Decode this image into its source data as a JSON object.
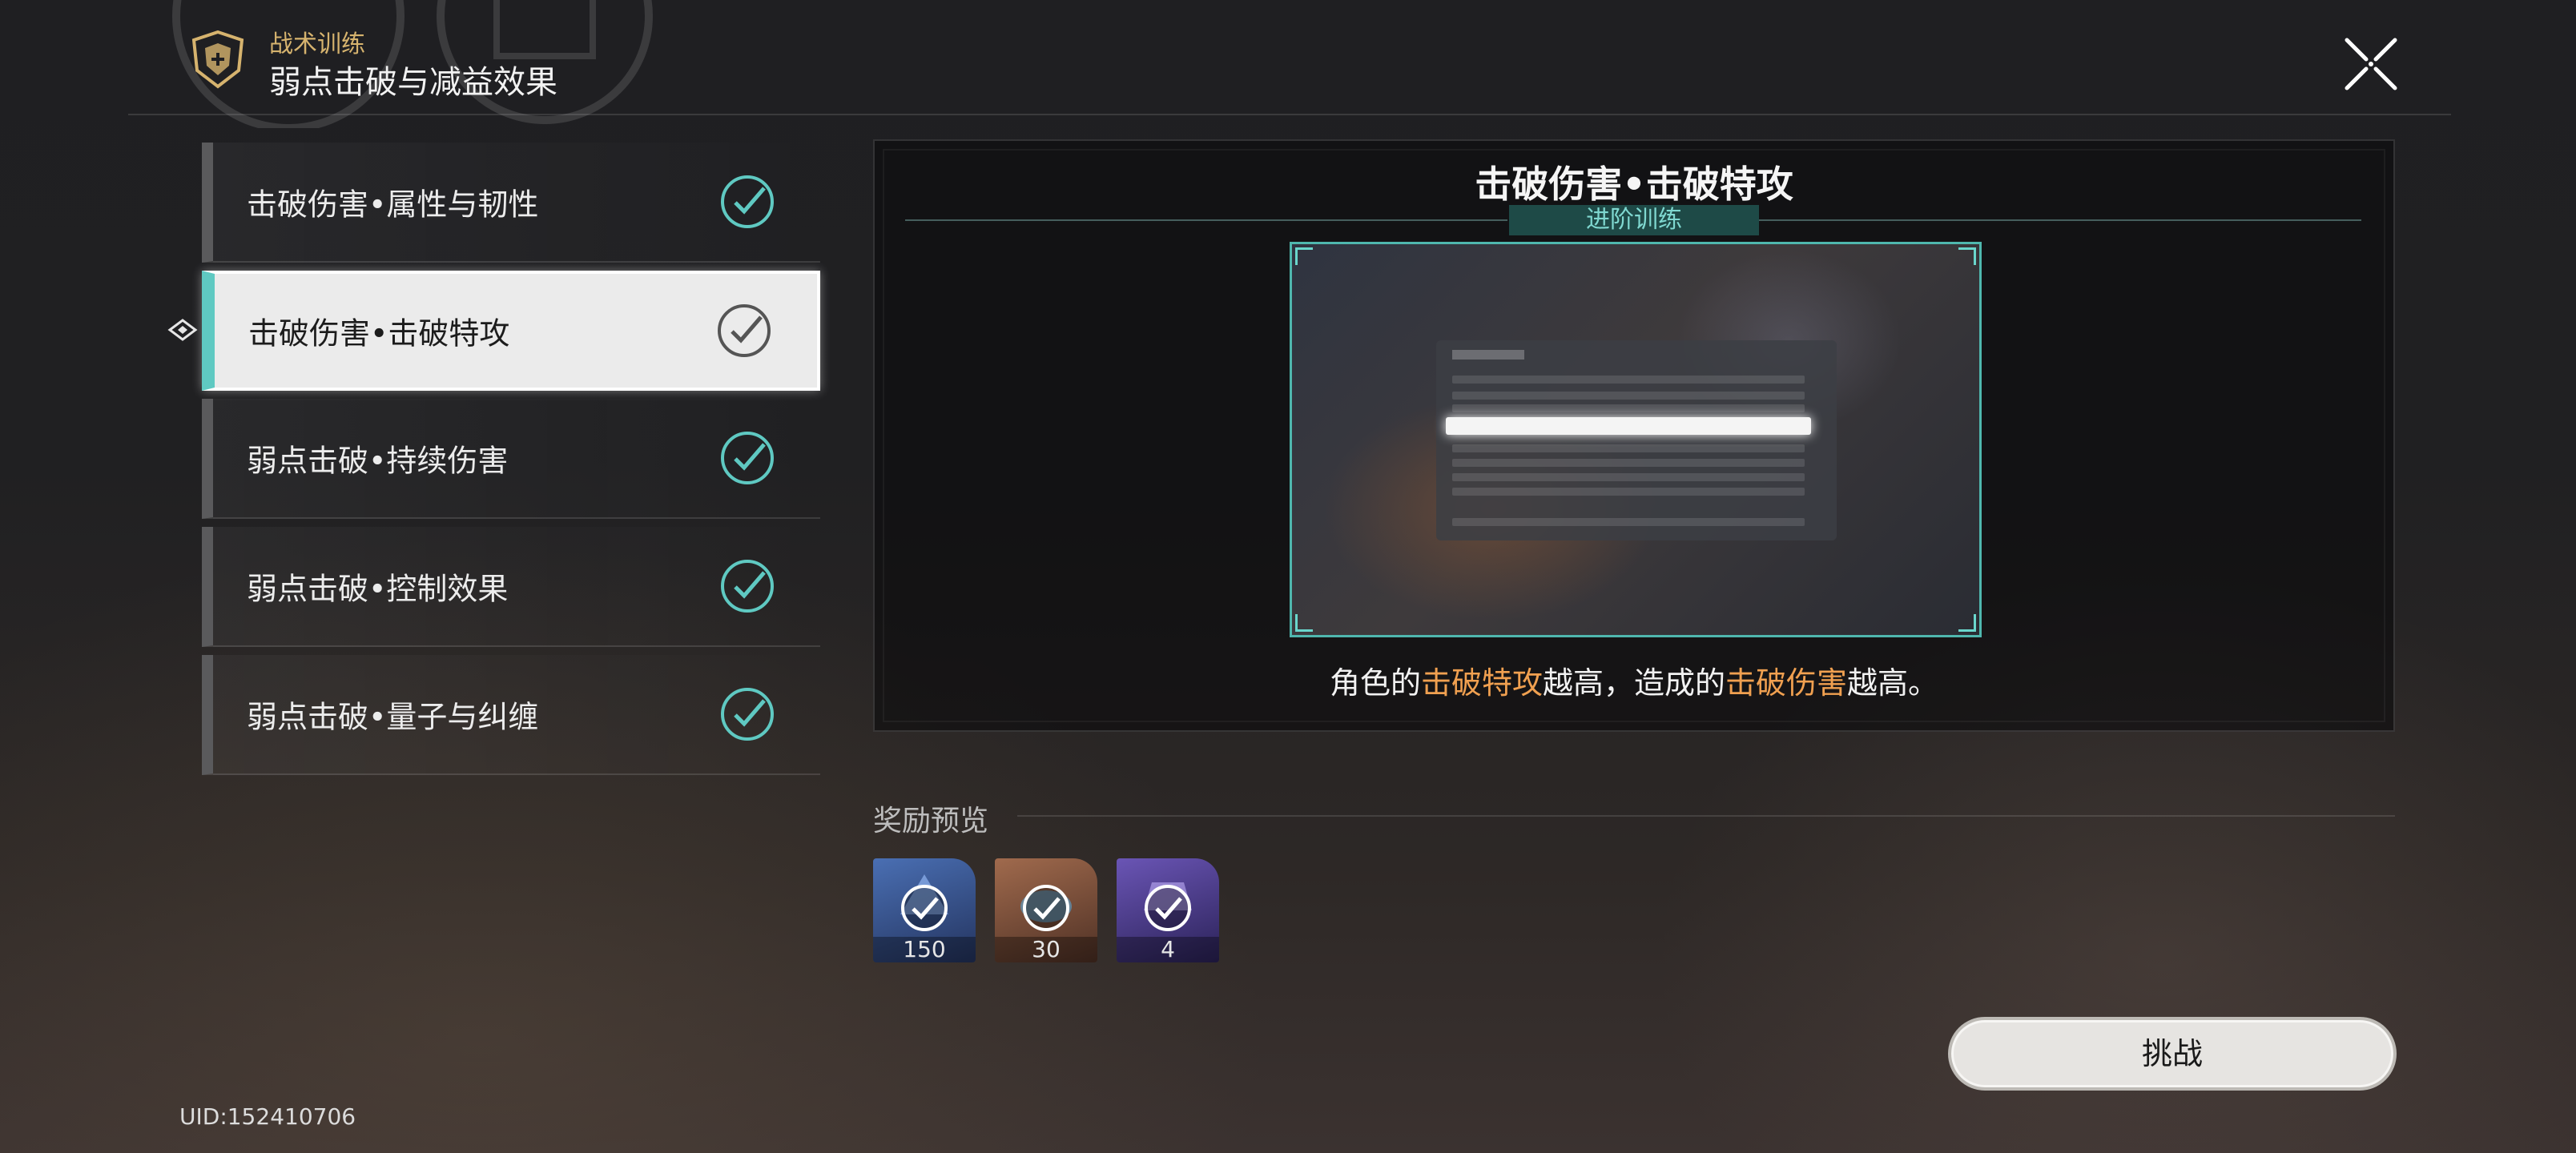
{
  "header": {
    "category": "战术训练",
    "title": "弱点击破与减益效果",
    "icon": "training-shield-icon",
    "close_icon": "close-icon"
  },
  "lessons": [
    {
      "label": "击破伤害•属性与韧性",
      "completed": true,
      "selected": false
    },
    {
      "label": "击破伤害•击破特攻",
      "completed": true,
      "selected": true
    },
    {
      "label": "弱点击破•持续伤害",
      "completed": true,
      "selected": false
    },
    {
      "label": "弱点击破•控制效果",
      "completed": true,
      "selected": false
    },
    {
      "label": "弱点击破•量子与纠缠",
      "completed": true,
      "selected": false
    }
  ],
  "panel": {
    "title": "击破伤害•击破特攻",
    "subtitle": "进阶训练",
    "description_parts": [
      "角色的",
      "击破特攻",
      "越高，造成的",
      "击破伤害",
      "越高。"
    ]
  },
  "rewards": {
    "title": "奖励预览",
    "items": [
      {
        "name": "stellar-jade-icon",
        "count": "150",
        "color": "#2c3e6b",
        "claimed": true
      },
      {
        "name": "credit-icon",
        "count": "30",
        "color": "#7a4a35",
        "claimed": true
      },
      {
        "name": "purple-material-icon",
        "count": "4",
        "color": "#3b2f6b",
        "claimed": true
      }
    ]
  },
  "challenge_button": "挑战",
  "uid": "UID:152410706",
  "colors": {
    "accent_teal": "#5fc9c2",
    "highlight_orange": "#f0a050",
    "category_gold": "#d6b36e"
  }
}
